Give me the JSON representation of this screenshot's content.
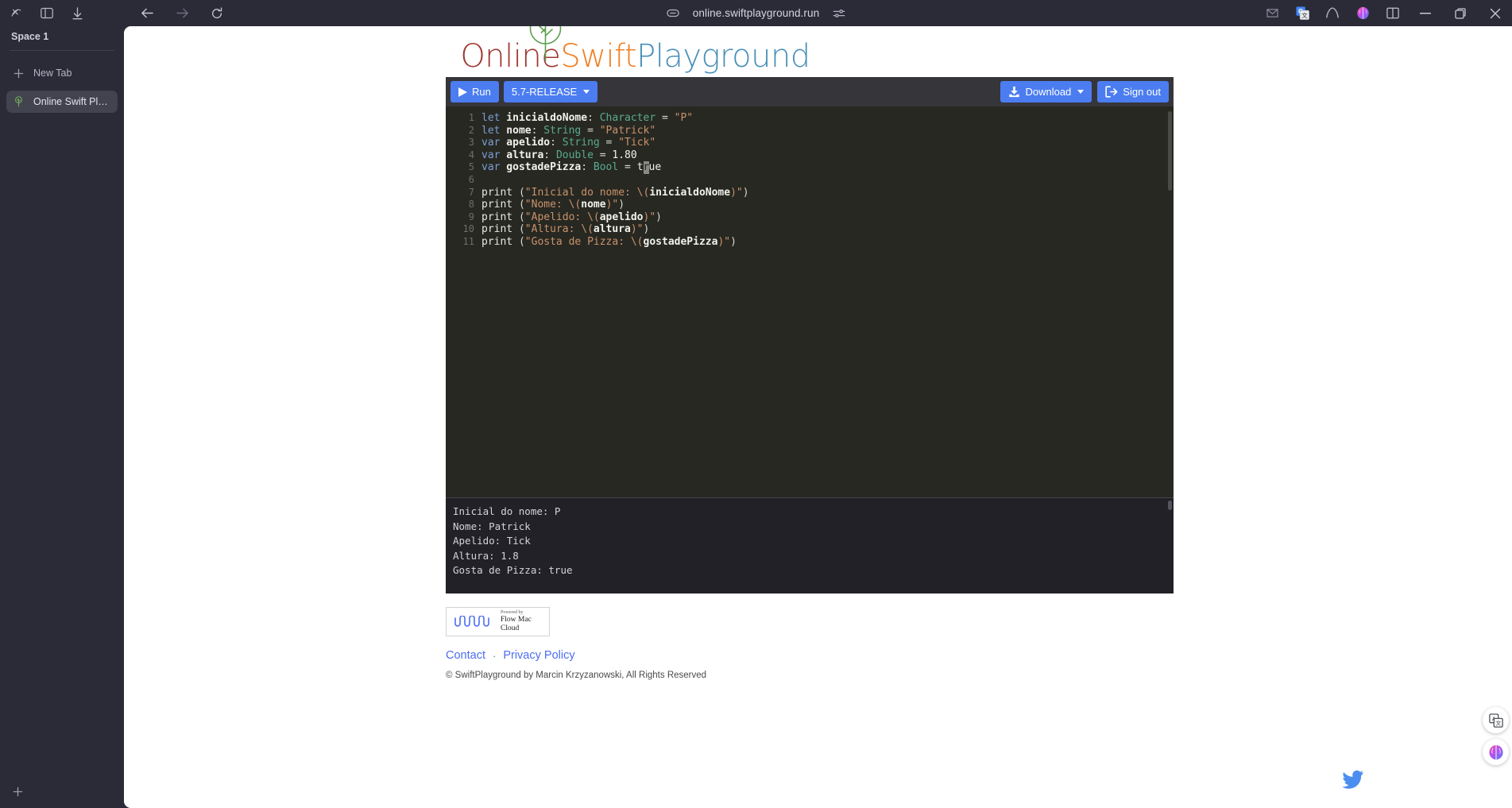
{
  "browser": {
    "icons": {
      "arc_logo": "arc-logo-icon",
      "toggle_sidebar": "toggle-sidebar-icon",
      "downloads": "downloads-icon",
      "back": "back-arrow-icon",
      "forward": "forward-arrow-icon",
      "reload": "reload-icon",
      "link": "link-icon",
      "sliders": "sliders-icon",
      "mail_ext": "mail-extension-icon",
      "translate_ext": "google-translate-icon",
      "arc_ext": "arc-extension-icon",
      "brain_ext": "brain-extension-icon",
      "split_view": "split-view-icon",
      "minimize": "minimize-icon",
      "maximize": "maximize-icon",
      "close": "close-icon"
    },
    "url": "online.swiftplayground.run"
  },
  "sidebar": {
    "space_label": "Space 1",
    "new_tab_label": "New Tab",
    "tabs": [
      {
        "label": "Online Swift Playgr...",
        "favicon": "tree-favicon",
        "active": true
      }
    ],
    "add_space_icon": "plus-icon"
  },
  "page": {
    "logo": {
      "part1": "Online",
      "part2": "Swift",
      "part3": "Playground",
      "colors": {
        "online": "#9e3831",
        "swift": "#ee8027",
        "playground": "#4a90b8",
        "tree": "#5d9e4e"
      }
    },
    "toolbar": {
      "run_label": "Run",
      "run_icon": "play-icon",
      "version_label": "5.7-RELEASE",
      "version_caret": "chevron-down-icon",
      "download_label": "Download",
      "download_icon": "download-icon",
      "download_caret": "chevron-down-icon",
      "signout_label": "Sign out",
      "signout_icon": "sign-out-icon",
      "accent_color": "#4c7df0",
      "bar_color": "#35353a"
    },
    "editor": {
      "background": "#272822",
      "line_numbers": [
        "1",
        "2",
        "3",
        "4",
        "5",
        "6",
        "7",
        "8",
        "9",
        "10",
        "11"
      ],
      "lines": [
        {
          "n": "1",
          "tokens": [
            {
              "t": "let",
              "c": "kw"
            },
            {
              "t": " inicialdoNome",
              "c": "id"
            },
            {
              "t": ": ",
              "c": "pun"
            },
            {
              "t": "Character",
              "c": "type"
            },
            {
              "t": " = ",
              "c": "pun"
            },
            {
              "t": "\"P\"",
              "c": "str"
            }
          ]
        },
        {
          "n": "2",
          "tokens": [
            {
              "t": "let",
              "c": "kw"
            },
            {
              "t": " nome",
              "c": "id"
            },
            {
              "t": ": ",
              "c": "pun"
            },
            {
              "t": "String",
              "c": "type"
            },
            {
              "t": " = ",
              "c": "pun"
            },
            {
              "t": "\"Patrick\"",
              "c": "str"
            }
          ]
        },
        {
          "n": "3",
          "tokens": [
            {
              "t": "var",
              "c": "kw"
            },
            {
              "t": " apelido",
              "c": "id"
            },
            {
              "t": ": ",
              "c": "pun"
            },
            {
              "t": "String",
              "c": "type"
            },
            {
              "t": " = ",
              "c": "pun"
            },
            {
              "t": "\"Tick\"",
              "c": "str"
            }
          ]
        },
        {
          "n": "4",
          "tokens": [
            {
              "t": "var",
              "c": "kw"
            },
            {
              "t": " altura",
              "c": "id"
            },
            {
              "t": ": ",
              "c": "pun"
            },
            {
              "t": "Double",
              "c": "type"
            },
            {
              "t": " = ",
              "c": "pun"
            },
            {
              "t": "1.80",
              "c": "num"
            }
          ]
        },
        {
          "n": "5",
          "tokens": [
            {
              "t": "var",
              "c": "kw"
            },
            {
              "t": " gostadePizza",
              "c": "id"
            },
            {
              "t": ": ",
              "c": "pun"
            },
            {
              "t": "Bool",
              "c": "type"
            },
            {
              "t": " = ",
              "c": "pun"
            },
            {
              "t": "t",
              "c": "num"
            },
            {
              "t": "r",
              "c": "cursor"
            },
            {
              "t": "ue",
              "c": "num"
            }
          ]
        },
        {
          "n": "6",
          "tokens": []
        },
        {
          "n": "7",
          "tokens": [
            {
              "t": "print ",
              "c": "fn"
            },
            {
              "t": "(",
              "c": "pun"
            },
            {
              "t": "\"Inicial do nome: \\(",
              "c": "str"
            },
            {
              "t": "inicialdoNome",
              "c": "id"
            },
            {
              "t": ")\"",
              "c": "str"
            },
            {
              "t": ")",
              "c": "pun"
            }
          ]
        },
        {
          "n": "8",
          "tokens": [
            {
              "t": "print ",
              "c": "fn"
            },
            {
              "t": "(",
              "c": "pun"
            },
            {
              "t": "\"Nome: \\(",
              "c": "str"
            },
            {
              "t": "nome",
              "c": "id"
            },
            {
              "t": ")\"",
              "c": "str"
            },
            {
              "t": ")",
              "c": "pun"
            }
          ]
        },
        {
          "n": "9",
          "tokens": [
            {
              "t": "print ",
              "c": "fn"
            },
            {
              "t": "(",
              "c": "pun"
            },
            {
              "t": "\"Apelido: \\(",
              "c": "str"
            },
            {
              "t": "apelido",
              "c": "id"
            },
            {
              "t": ")\"",
              "c": "str"
            },
            {
              "t": ")",
              "c": "pun"
            }
          ]
        },
        {
          "n": "10",
          "tokens": [
            {
              "t": "print ",
              "c": "fn"
            },
            {
              "t": "(",
              "c": "pun"
            },
            {
              "t": "\"Altura: \\(",
              "c": "str"
            },
            {
              "t": "altura",
              "c": "id"
            },
            {
              "t": ")\"",
              "c": "str"
            },
            {
              "t": ")",
              "c": "pun"
            }
          ]
        },
        {
          "n": "11",
          "tokens": [
            {
              "t": "print ",
              "c": "fn"
            },
            {
              "t": "(",
              "c": "pun"
            },
            {
              "t": "\"Gosta de Pizza: \\(",
              "c": "str"
            },
            {
              "t": "gostadePizza",
              "c": "id"
            },
            {
              "t": ")\"",
              "c": "str"
            },
            {
              "t": ")",
              "c": "pun"
            }
          ]
        }
      ]
    },
    "console": {
      "background": "#212127",
      "lines": [
        "Inicial do nome: P",
        "Nome: Patrick",
        "Apelido: Tick",
        "Altura: 1.8",
        "Gosta de Pizza: true"
      ]
    },
    "footer": {
      "powered_by_small": "Powered by",
      "powered_by_name": "Flow Mac Cloud",
      "powered_logo": "wave-logo-icon",
      "contact_label": "Contact",
      "separator": "·",
      "privacy_label": "Privacy Policy",
      "copyright": "© SwiftPlayground by Marcin Krzyzanowski, All Rights Reserved",
      "twitter_icon": "twitter-icon",
      "link_color": "#4c6ef0"
    },
    "fabs": {
      "translate": "translate-icon",
      "brain": "brain-icon"
    }
  }
}
